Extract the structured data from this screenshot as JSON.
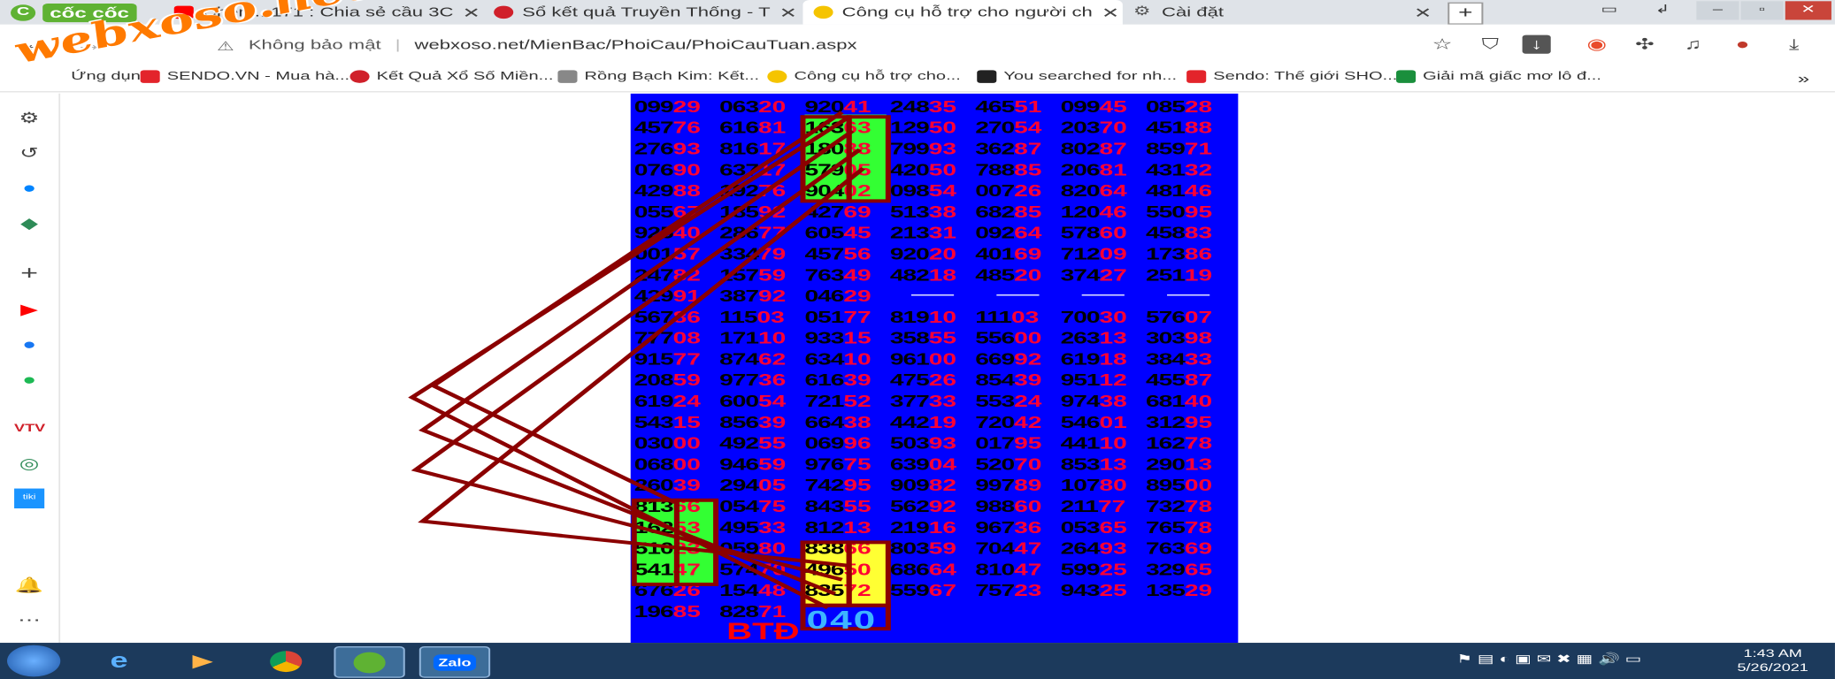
{
  "browser": {
    "brand": "cốc cốc",
    "tabs": [
      {
        "title": "Chém...171 : Chia sẻ cầu 3C",
        "active": false
      },
      {
        "title": "Sổ kết quả Truyền Thống - T",
        "active": false
      },
      {
        "title": "Công cụ hỗ trợ cho người ch",
        "active": true
      },
      {
        "title": "Cài đặt",
        "active": false
      }
    ],
    "security_label": "Không bảo mật",
    "url": "webxoso.net/MienBac/PhoiCau/PhoiCauTuan.aspx",
    "bookmarks": [
      "Ứng dụng",
      "SENDO.VN - Mua hà...",
      "Kết Quả Xổ Số Miền...",
      "Rồng Bạch Kim: Kết...",
      "Công cụ hỗ trợ cho...",
      "You searched for nh...",
      "Sendo: Thế giới SHO...",
      "Giải mã giấc mơ lô đ..."
    ],
    "bookmark_overflow": "»"
  },
  "watermark": "webxoso.net",
  "grid": {
    "rows": [
      [
        [
          "099",
          "29"
        ],
        [
          "063",
          "20"
        ],
        [
          "920",
          "41"
        ],
        [
          "248",
          "35"
        ],
        [
          "465",
          "51"
        ],
        [
          "099",
          "45"
        ],
        [
          "085",
          "28"
        ]
      ],
      [
        [
          "457",
          "76"
        ],
        [
          "616",
          "81"
        ],
        [
          "163",
          "63"
        ],
        [
          "129",
          "50"
        ],
        [
          "270",
          "54"
        ],
        [
          "203",
          "70"
        ],
        [
          "451",
          "88"
        ]
      ],
      [
        [
          "276",
          "93"
        ],
        [
          "816",
          "17"
        ],
        [
          "180",
          "88"
        ],
        [
          "799",
          "93"
        ],
        [
          "362",
          "87"
        ],
        [
          "802",
          "87"
        ],
        [
          "859",
          "71"
        ]
      ],
      [
        [
          "076",
          "90"
        ],
        [
          "637",
          "17"
        ],
        [
          "579",
          "05"
        ],
        [
          "420",
          "50"
        ],
        [
          "788",
          "85"
        ],
        [
          "206",
          "81"
        ],
        [
          "431",
          "32"
        ]
      ],
      [
        [
          "429",
          "88"
        ],
        [
          "192",
          "76"
        ],
        [
          "904",
          "02"
        ],
        [
          "098",
          "54"
        ],
        [
          "007",
          "26"
        ],
        [
          "820",
          "64"
        ],
        [
          "481",
          "46"
        ]
      ],
      [
        [
          "055",
          "67"
        ],
        [
          "185",
          "92"
        ],
        [
          "427",
          "69"
        ],
        [
          "513",
          "38"
        ],
        [
          "682",
          "85"
        ],
        [
          "120",
          "46"
        ],
        [
          "550",
          "95"
        ]
      ],
      [
        [
          "925",
          "40"
        ],
        [
          "286",
          "77"
        ],
        [
          "605",
          "45"
        ],
        [
          "213",
          "31"
        ],
        [
          "092",
          "64"
        ],
        [
          "578",
          "60"
        ],
        [
          "458",
          "83"
        ]
      ],
      [
        [
          "001",
          "57"
        ],
        [
          "334",
          "79"
        ],
        [
          "457",
          "56"
        ],
        [
          "920",
          "20"
        ],
        [
          "401",
          "69"
        ],
        [
          "712",
          "09"
        ],
        [
          "173",
          "86"
        ]
      ],
      [
        [
          "247",
          "82"
        ],
        [
          "157",
          "59"
        ],
        [
          "763",
          "49"
        ],
        [
          "482",
          "18"
        ],
        [
          "485",
          "20"
        ],
        [
          "374",
          "27"
        ],
        [
          "251",
          "19"
        ]
      ],
      [
        [
          "429",
          "91"
        ],
        [
          "387",
          "92"
        ],
        [
          "046",
          "29"
        ],
        null,
        null,
        null,
        null
      ],
      [
        [
          "567",
          "86"
        ],
        [
          "115",
          "03"
        ],
        [
          "051",
          "77"
        ],
        [
          "819",
          "10"
        ],
        [
          "111",
          "03"
        ],
        [
          "700",
          "30"
        ],
        [
          "576",
          "07"
        ]
      ],
      [
        [
          "777",
          "08"
        ],
        [
          "171",
          "10"
        ],
        [
          "933",
          "15"
        ],
        [
          "358",
          "55"
        ],
        [
          "556",
          "00"
        ],
        [
          "263",
          "13"
        ],
        [
          "303",
          "98"
        ]
      ],
      [
        [
          "915",
          "77"
        ],
        [
          "874",
          "62"
        ],
        [
          "634",
          "10"
        ],
        [
          "961",
          "00"
        ],
        [
          "669",
          "92"
        ],
        [
          "619",
          "18"
        ],
        [
          "384",
          "33"
        ]
      ],
      [
        [
          "208",
          "59"
        ],
        [
          "977",
          "36"
        ],
        [
          "616",
          "39"
        ],
        [
          "475",
          "26"
        ],
        [
          "854",
          "39"
        ],
        [
          "951",
          "12"
        ],
        [
          "455",
          "87"
        ]
      ],
      [
        [
          "619",
          "24"
        ],
        [
          "600",
          "54"
        ],
        [
          "721",
          "52"
        ],
        [
          "377",
          "33"
        ],
        [
          "553",
          "24"
        ],
        [
          "974",
          "38"
        ],
        [
          "681",
          "40"
        ]
      ],
      [
        [
          "543",
          "15"
        ],
        [
          "856",
          "39"
        ],
        [
          "664",
          "38"
        ],
        [
          "442",
          "19"
        ],
        [
          "720",
          "42"
        ],
        [
          "546",
          "01"
        ],
        [
          "312",
          "95"
        ]
      ],
      [
        [
          "030",
          "00"
        ],
        [
          "492",
          "55"
        ],
        [
          "069",
          "96"
        ],
        [
          "503",
          "93"
        ],
        [
          "017",
          "95"
        ],
        [
          "441",
          "10"
        ],
        [
          "162",
          "78"
        ]
      ],
      [
        [
          "068",
          "00"
        ],
        [
          "946",
          "59"
        ],
        [
          "976",
          "75"
        ],
        [
          "639",
          "04"
        ],
        [
          "520",
          "70"
        ],
        [
          "853",
          "13"
        ],
        [
          "290",
          "13"
        ]
      ],
      [
        [
          "260",
          "39"
        ],
        [
          "294",
          "05"
        ],
        [
          "742",
          "95"
        ],
        [
          "909",
          "82"
        ],
        [
          "997",
          "89"
        ],
        [
          "107",
          "80"
        ],
        [
          "895",
          "00"
        ]
      ],
      [
        [
          "813",
          "66"
        ],
        [
          "054",
          "75"
        ],
        [
          "843",
          "55"
        ],
        [
          "562",
          "92"
        ],
        [
          "988",
          "60"
        ],
        [
          "211",
          "77"
        ],
        [
          "732",
          "78"
        ]
      ],
      [
        [
          "162",
          "53"
        ],
        [
          "495",
          "33"
        ],
        [
          "812",
          "13"
        ],
        [
          "219",
          "16"
        ],
        [
          "967",
          "36"
        ],
        [
          "053",
          "65"
        ],
        [
          "765",
          "78"
        ]
      ],
      [
        [
          "510",
          "23"
        ],
        [
          "059",
          "80"
        ],
        [
          "838",
          "66"
        ],
        [
          "803",
          "59"
        ],
        [
          "704",
          "47"
        ],
        [
          "264",
          "93"
        ],
        [
          "763",
          "69"
        ]
      ],
      [
        [
          "541",
          "47"
        ],
        [
          "574",
          "70"
        ],
        [
          "496",
          "50"
        ],
        [
          "686",
          "64"
        ],
        [
          "810",
          "47"
        ],
        [
          "599",
          "25"
        ],
        [
          "329",
          "65"
        ]
      ],
      [
        [
          "676",
          "26"
        ],
        [
          "154",
          "48"
        ],
        [
          "835",
          "72"
        ],
        [
          "559",
          "67"
        ],
        [
          "757",
          "23"
        ],
        [
          "943",
          "25"
        ],
        [
          "135",
          "29"
        ]
      ],
      [
        [
          "196",
          "85"
        ],
        [
          "828",
          "71"
        ],
        null,
        null,
        null,
        null,
        null
      ]
    ]
  },
  "annotation_label": "BTĐ",
  "prediction": "040",
  "taskbar": {
    "time": "1:43 AM",
    "date": "5/26/2021",
    "zalo": "Zalo"
  }
}
